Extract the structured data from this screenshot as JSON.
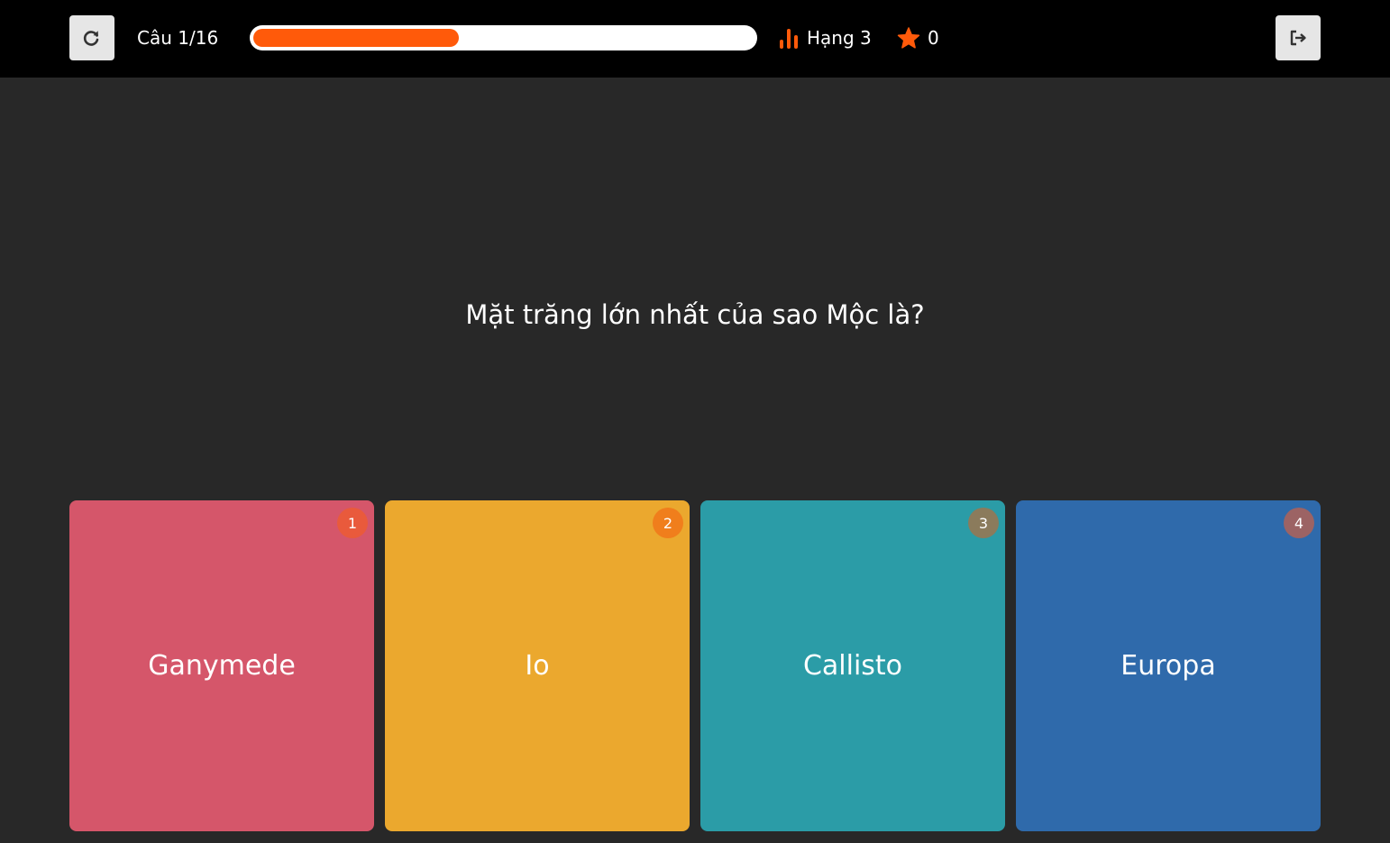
{
  "header": {
    "counter": "Câu 1/16",
    "progress": 0.41,
    "rank_label": "Hạng 3",
    "score": "0",
    "accent_color": "#ff5a0a",
    "reload_icon": "reload-icon",
    "exit_icon": "exit-icon"
  },
  "question": {
    "text": "Mặt trăng lớn nhất của sao Mộc là?"
  },
  "answers": [
    {
      "number": "1",
      "label": "Ganymede",
      "card_color": "#d5566a",
      "badge_color": "#e95a3c"
    },
    {
      "number": "2",
      "label": "Io",
      "card_color": "#eba82e",
      "badge_color": "#f07e1c"
    },
    {
      "number": "3",
      "label": "Callisto",
      "card_color": "#2b9ca7",
      "badge_color": "#8b7b5c"
    },
    {
      "number": "4",
      "label": "Europa",
      "card_color": "#2f6aab",
      "badge_color": "#9c6364"
    }
  ]
}
